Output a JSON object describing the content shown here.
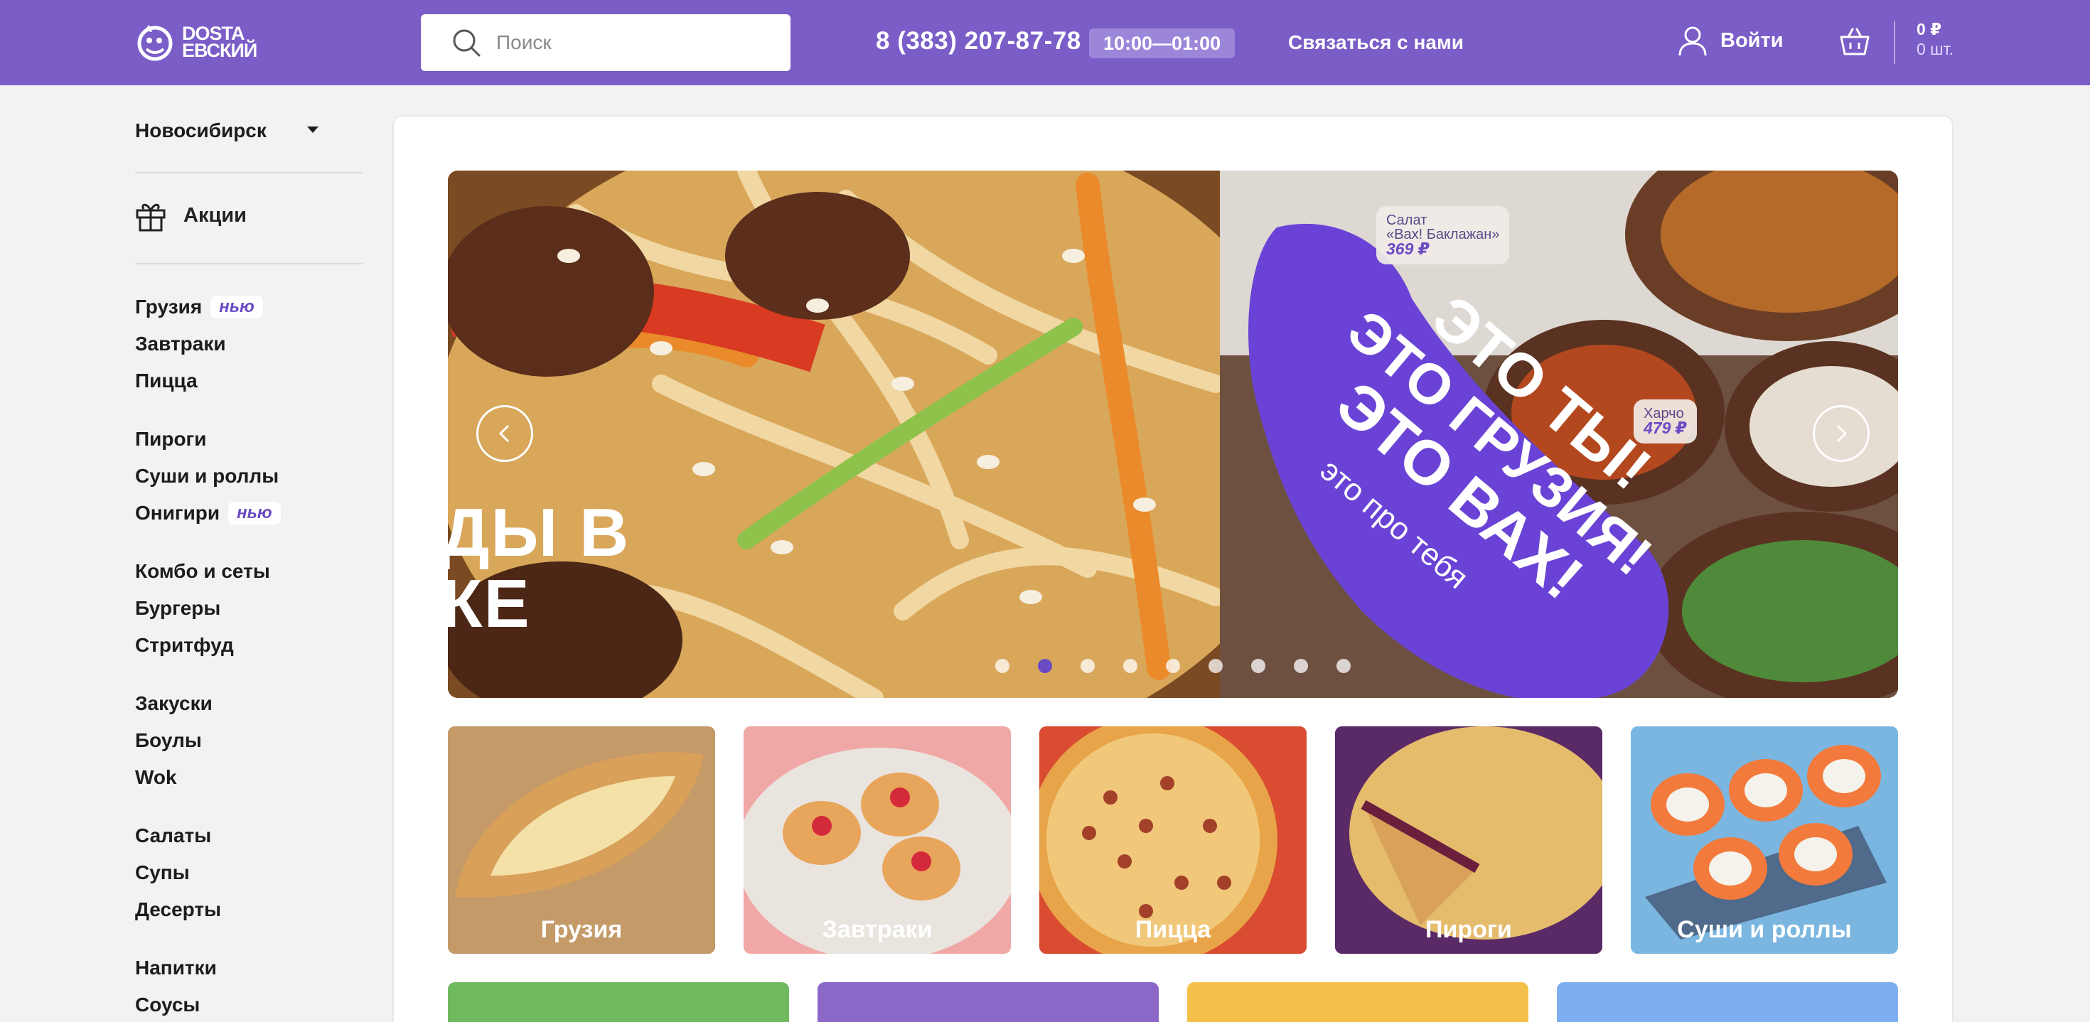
{
  "header": {
    "logo_line1": "DOSTA",
    "logo_line2": "ЕВСКИЙ",
    "search_placeholder": "Поиск",
    "phone": "8 (383) 207-87-78",
    "hours": "10:00—01:00",
    "contact": "Связаться с нами",
    "login": "Войти",
    "cart_sum": "0 ₽",
    "cart_count": "0 шт."
  },
  "sidebar": {
    "city": "Новосибирск",
    "promo": "Акции",
    "badge_new": "нью",
    "items": [
      {
        "label": "Грузия",
        "new": true
      },
      {
        "label": "Завтраки"
      },
      {
        "label": "Пицца"
      },
      {
        "label": "Пироги"
      },
      {
        "label": "Суши и роллы"
      },
      {
        "label": "Онигири",
        "new": true
      },
      {
        "label": "Комбо и сеты"
      },
      {
        "label": "Бургеры"
      },
      {
        "label": "Стритфуд"
      },
      {
        "label": "Закуски"
      },
      {
        "label": "Боулы"
      },
      {
        "label": "Wok"
      },
      {
        "label": "Салаты"
      },
      {
        "label": "Супы"
      },
      {
        "label": "Десерты"
      },
      {
        "label": "Напитки"
      },
      {
        "label": "Соусы"
      }
    ]
  },
  "carousel": {
    "left_text_line1": "ДЫ В",
    "left_text_line2": "КЕ",
    "bubble_line1": "ЭТО ТЫ!",
    "bubble_line2": "ЭТО ГРУЗИЯ!",
    "bubble_line3": "ЭТО ВАХ!",
    "bubble_small": "это про тебя",
    "tag1_name1": "Салат",
    "tag1_name2": "«Вах! Баклажан»",
    "tag1_price": "369 ₽",
    "tag2_name": "Харчо",
    "tag2_price": "479 ₽",
    "active_slide": 2,
    "slide_count": 9
  },
  "categories": [
    {
      "label": "Грузия",
      "color": "#c29a66"
    },
    {
      "label": "Завтраки",
      "color": "#f0a8a6"
    },
    {
      "label": "Пицца",
      "color": "#d94c32"
    },
    {
      "label": "Пироги",
      "color": "#5a2a66"
    },
    {
      "label": "Суши и роллы",
      "color": "#7ab6e0"
    }
  ],
  "categories_row2_colors": [
    "#6fba5e",
    "#8b68c8",
    "#f3c14a",
    "#7daef0"
  ],
  "colors": {
    "brand": "#7a5dc7",
    "accent": "#6a4bc4"
  }
}
